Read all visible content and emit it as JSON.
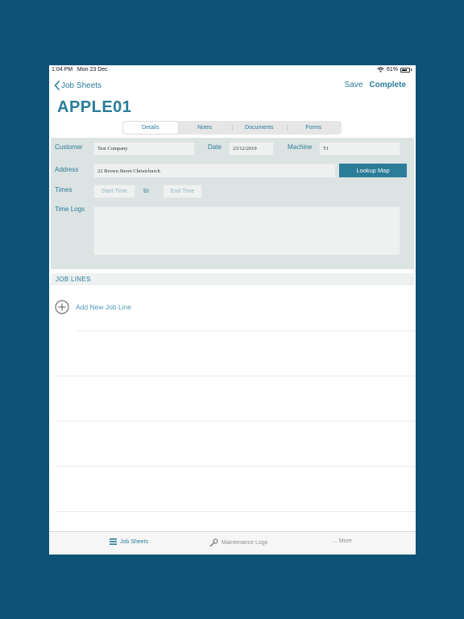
{
  "status_bar": {
    "time": "1:04 PM",
    "date": "Mon 23 Dec",
    "battery": "61%"
  },
  "nav": {
    "back_label": "Job Sheets",
    "save_label": "Save",
    "complete_label": "Complete"
  },
  "title": "APPLE01",
  "tabs": [
    {
      "label": "Details",
      "active": true
    },
    {
      "label": "Notes",
      "active": false
    },
    {
      "label": "Documents",
      "active": false
    },
    {
      "label": "Forms",
      "active": false
    }
  ],
  "details": {
    "customer_label": "Customer",
    "customer_value": "Test Company",
    "date_label": "Date",
    "date_value": "23/12/2019",
    "machine_label": "Machine",
    "machine_value": "T1",
    "address_label": "Address",
    "address_value": "22 Brown Street Christchurch",
    "lookup_map_label": "Lookup Map",
    "times_label": "Times",
    "start_time_placeholder": "Start Time",
    "to_label": "to",
    "end_time_placeholder": "End Time",
    "time_logs_label": "Time Logs",
    "time_logs_value": ""
  },
  "job_lines": {
    "header": "JOB LINES",
    "add_label": "Add New Job Line"
  },
  "tabbar": [
    {
      "label": "Job Sheets",
      "icon": "list-icon",
      "active": true
    },
    {
      "label": "Maintenance Logs",
      "icon": "wrench-icon",
      "active": false
    },
    {
      "label": "... More",
      "icon": "more-icon",
      "active": false
    }
  ],
  "colors": {
    "accent": "#2a7c98",
    "background": "#0e5376",
    "panel": "#dce3e3"
  }
}
